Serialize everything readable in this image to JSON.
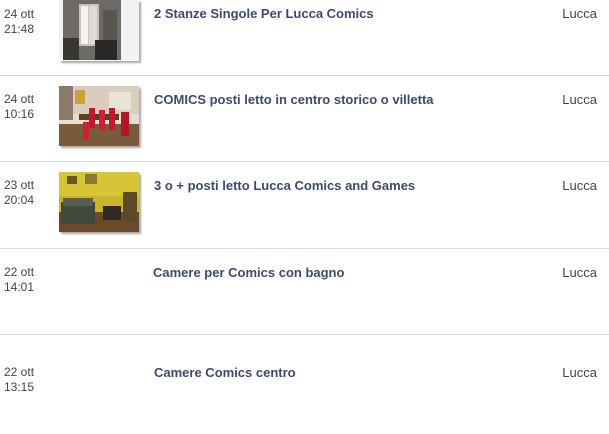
{
  "listings": [
    {
      "date": "24 ott",
      "time": "21:48",
      "title": "2 Stanze Singole Per Lucca Comics",
      "city": "Lucca",
      "photo": "dark-room-photo"
    },
    {
      "date": "24 ott",
      "time": "10:16",
      "title": "COMICS posti letto in centro storico o villetta",
      "city": "Lucca",
      "photo": "dining-room-photo"
    },
    {
      "date": "23 ott",
      "time": "20:04",
      "title": "3 o + posti letto Lucca Comics and Games",
      "city": "Lucca",
      "photo": "yellow-living-room-photo"
    },
    {
      "date": "22 ott",
      "time": "14:01",
      "title": "Camere per Comics con bagno",
      "city": "Lucca",
      "photo": ""
    },
    {
      "date": "22 ott",
      "time": "13:15",
      "title": "Camere Comics centro",
      "city": "Lucca",
      "photo": ""
    }
  ]
}
